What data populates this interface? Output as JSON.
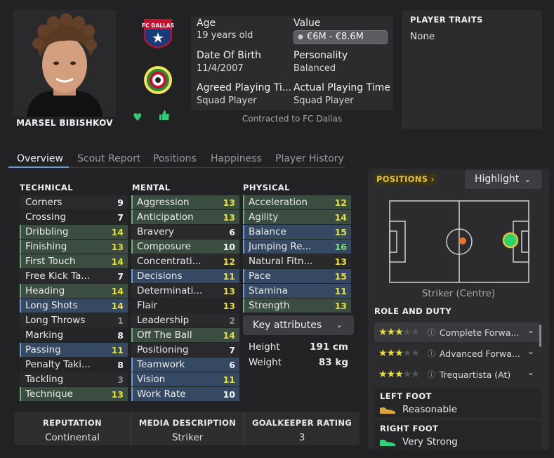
{
  "player": {
    "name": "MARSEL BIBISHKOV",
    "club_logo_text": "FC DALLAS",
    "age_label": "Age",
    "age": "19 years old",
    "value_label": "Value",
    "value": "€6M - €8.6M",
    "dob_label": "Date Of Birth",
    "dob": "11/4/2007",
    "personality_label": "Personality",
    "personality": "Balanced",
    "agreed_label": "Agreed Playing Ti...",
    "agreed": "Squad Player",
    "actual_label": "Actual Playing Time",
    "actual": "Squad Player",
    "contract": "Contracted to FC Dallas"
  },
  "traits": {
    "title": "PLAYER TRAITS",
    "value": "None"
  },
  "tabs": [
    "Overview",
    "Scout Report",
    "Positions",
    "Happiness",
    "Player History"
  ],
  "technical": {
    "title": "TECHNICAL",
    "rows": [
      {
        "name": "Corners",
        "value": "9",
        "style": "plain",
        "vc": ""
      },
      {
        "name": "Crossing",
        "value": "7",
        "style": "alt",
        "vc": ""
      },
      {
        "name": "Dribbling",
        "value": "14",
        "style": "green",
        "vc": "y"
      },
      {
        "name": "Finishing",
        "value": "13",
        "style": "green",
        "vc": "y"
      },
      {
        "name": "First Touch",
        "value": "14",
        "style": "green",
        "vc": "y"
      },
      {
        "name": "Free Kick Ta...",
        "value": "7",
        "style": "plain",
        "vc": ""
      },
      {
        "name": "Heading",
        "value": "14",
        "style": "green",
        "vc": "y"
      },
      {
        "name": "Long Shots",
        "value": "14",
        "style": "blue",
        "vc": "y"
      },
      {
        "name": "Long Throws",
        "value": "1",
        "style": "plain",
        "vc": "dim"
      },
      {
        "name": "Marking",
        "value": "8",
        "style": "alt",
        "vc": ""
      },
      {
        "name": "Passing",
        "value": "11",
        "style": "blue",
        "vc": "y"
      },
      {
        "name": "Penalty Taki...",
        "value": "8",
        "style": "alt",
        "vc": ""
      },
      {
        "name": "Tackling",
        "value": "3",
        "style": "plain",
        "vc": "dim"
      },
      {
        "name": "Technique",
        "value": "13",
        "style": "green",
        "vc": "y"
      }
    ]
  },
  "mental": {
    "title": "MENTAL",
    "rows": [
      {
        "name": "Aggression",
        "value": "13",
        "style": "green",
        "vc": "y"
      },
      {
        "name": "Anticipation",
        "value": "13",
        "style": "green",
        "vc": "y"
      },
      {
        "name": "Bravery",
        "value": "6",
        "style": "plain",
        "vc": ""
      },
      {
        "name": "Composure",
        "value": "10",
        "style": "green",
        "vc": ""
      },
      {
        "name": "Concentrati...",
        "value": "12",
        "style": "plain",
        "vc": "y"
      },
      {
        "name": "Decisions",
        "value": "11",
        "style": "blue",
        "vc": "y"
      },
      {
        "name": "Determinati...",
        "value": "13",
        "style": "plain",
        "vc": "y"
      },
      {
        "name": "Flair",
        "value": "13",
        "style": "alt",
        "vc": "y"
      },
      {
        "name": "Leadership",
        "value": "2",
        "style": "plain",
        "vc": "dim"
      },
      {
        "name": "Off The Ball",
        "value": "14",
        "style": "green",
        "vc": "y"
      },
      {
        "name": "Positioning",
        "value": "7",
        "style": "plain",
        "vc": ""
      },
      {
        "name": "Teamwork",
        "value": "6",
        "style": "blue",
        "vc": ""
      },
      {
        "name": "Vision",
        "value": "11",
        "style": "blue",
        "vc": "y"
      },
      {
        "name": "Work Rate",
        "value": "10",
        "style": "blue",
        "vc": ""
      }
    ]
  },
  "physical": {
    "title": "PHYSICAL",
    "rows": [
      {
        "name": "Acceleration",
        "value": "12",
        "style": "green",
        "vc": "y"
      },
      {
        "name": "Agility",
        "value": "14",
        "style": "green",
        "vc": "y"
      },
      {
        "name": "Balance",
        "value": "15",
        "style": "blue",
        "vc": "y"
      },
      {
        "name": "Jumping Re...",
        "value": "16",
        "style": "blue",
        "vc": "gy"
      },
      {
        "name": "Natural Fitn...",
        "value": "13",
        "style": "plain",
        "vc": "y"
      },
      {
        "name": "Pace",
        "value": "15",
        "style": "blue",
        "vc": "y"
      },
      {
        "name": "Stamina",
        "value": "11",
        "style": "blue",
        "vc": "y"
      },
      {
        "name": "Strength",
        "value": "13",
        "style": "green",
        "vc": "y"
      }
    ]
  },
  "key_attributes_label": "Key attributes",
  "height_label": "Height",
  "height": "191 cm",
  "weight_label": "Weight",
  "weight": "83 kg",
  "bottom": {
    "reputation_label": "REPUTATION",
    "reputation": "Continental",
    "media_label": "MEDIA DESCRIPTION",
    "media": "Striker",
    "gk_label": "GOALKEEPER RATING",
    "gk": "3"
  },
  "positions": {
    "title": "POSITIONS",
    "highlight_label": "Highlight",
    "position_name": "Striker (Centre)",
    "role_title": "ROLE AND DUTY",
    "roles": [
      {
        "name": "Complete Forwa...",
        "stars": 3
      },
      {
        "name": "Advanced Forwa...",
        "stars": 3
      },
      {
        "name": "Trequartista (At)",
        "stars": 3
      }
    ],
    "left_foot_label": "LEFT FOOT",
    "left_foot": "Reasonable",
    "right_foot_label": "RIGHT FOOT",
    "right_foot": "Very Strong"
  },
  "colors": {
    "accent_yellow": "#e8df3a",
    "pitch_green": "#2bd46a",
    "left_boot": "#d9a43a",
    "right_boot": "#2fd47a"
  }
}
